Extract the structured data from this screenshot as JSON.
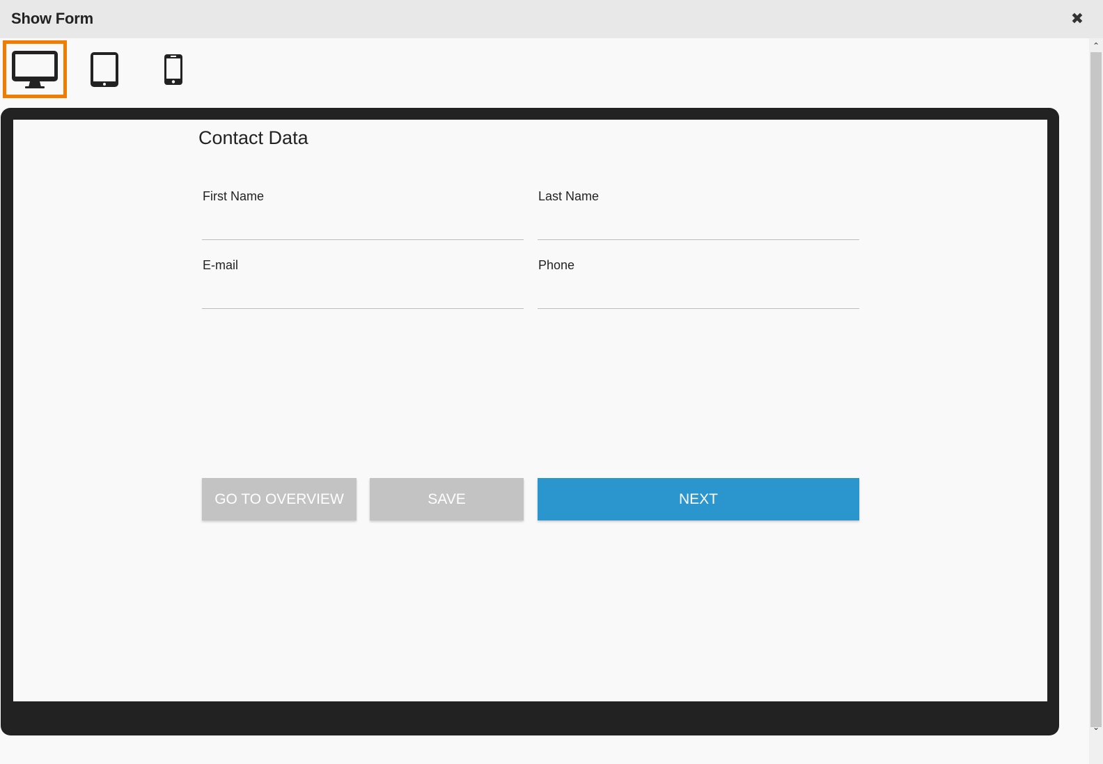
{
  "window": {
    "title": "Show Form",
    "close_glyph": "✖"
  },
  "device_toggle": {
    "items": [
      {
        "name": "desktop",
        "icon": "desktop-icon",
        "active": true
      },
      {
        "name": "tablet",
        "icon": "tablet-icon",
        "active": false
      },
      {
        "name": "phone",
        "icon": "phone-icon",
        "active": false
      }
    ],
    "active_color": "#f07d00"
  },
  "form": {
    "heading": "Contact Data",
    "fields": {
      "first_name": {
        "label": "First Name",
        "value": ""
      },
      "last_name": {
        "label": "Last Name",
        "value": ""
      },
      "email": {
        "label": "E-mail",
        "value": ""
      },
      "phone": {
        "label": "Phone",
        "value": ""
      }
    },
    "buttons": {
      "overview": "GO TO OVERVIEW",
      "save": "SAVE",
      "next": "NEXT"
    }
  },
  "scrollbar": {
    "up_glyph": "⌃",
    "down_glyph": "⌄"
  },
  "colors": {
    "primary": "#2b96cd",
    "disabled": "#c3c3c3",
    "frame": "#222222"
  }
}
